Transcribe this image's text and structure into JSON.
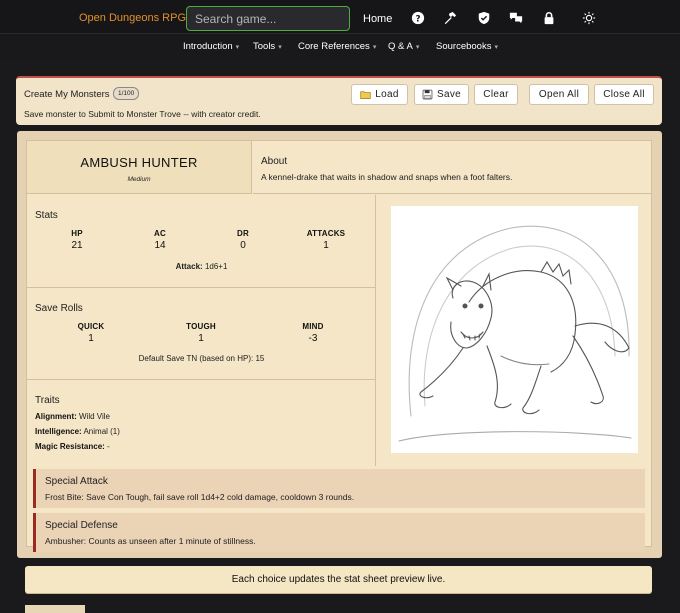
{
  "nav": {
    "brand": "Open Dungeons RPG™",
    "search_placeholder": "Search game...",
    "home": "Home",
    "icons": [
      "help-icon",
      "hammer-icon",
      "shield-icon",
      "chat-icon",
      "lock-icon",
      "sun-icon"
    ]
  },
  "subnav": {
    "items": [
      "Introduction",
      "Tools",
      "Core References",
      "Q & A",
      "Sourcebooks"
    ]
  },
  "create": {
    "title": "Create My Monsters",
    "count": "1/100",
    "note": "Save monster to Submit to Monster Trove -- with creator credit.",
    "buttons": {
      "load": "Load",
      "save": "Save",
      "clear": "Clear",
      "open_all": "Open All",
      "close_all": "Close All"
    }
  },
  "monster": {
    "name": "AMBUSH HUNTER",
    "size": "Medium",
    "about_title": "About",
    "about_text": "A kennel-drake that waits in shadow and snaps when a foot falters.",
    "stats_title": "Stats",
    "stats": [
      {
        "label": "HP",
        "value": "21"
      },
      {
        "label": "AC",
        "value": "14"
      },
      {
        "label": "DR",
        "value": "0"
      },
      {
        "label": "ATTACKS",
        "value": "1"
      }
    ],
    "attack_label": "Attack:",
    "attack_value": "1d6+1",
    "saves_title": "Save Rolls",
    "saves": [
      {
        "label": "QUICK",
        "value": "1"
      },
      {
        "label": "TOUGH",
        "value": "1"
      },
      {
        "label": "MIND",
        "value": "-3"
      }
    ],
    "default_save": "Default Save TN (based on HP): 15",
    "traits_title": "Traits",
    "traits": [
      {
        "label": "Alignment:",
        "value": "Wild Vile"
      },
      {
        "label": "Intelligence:",
        "value": "Animal (1)"
      },
      {
        "label": "Magic Resistance:",
        "value": "-"
      }
    ],
    "special_attack_title": "Special Attack",
    "special_attack_text": "Frost Bite: Save Con Tough, fail save roll 1d4+2 cold damage, cooldown 3 rounds.",
    "special_defense_title": "Special Defense",
    "special_defense_text": "Ambusher: Counts as unseen after 1 minute of stillness."
  },
  "footer_note": "Each choice updates the stat sheet preview live.",
  "colors": {
    "accent": "#e0902a",
    "search_border": "#4caf3c",
    "panel_border": "#c0504a",
    "special_border": "#9b2a22"
  }
}
